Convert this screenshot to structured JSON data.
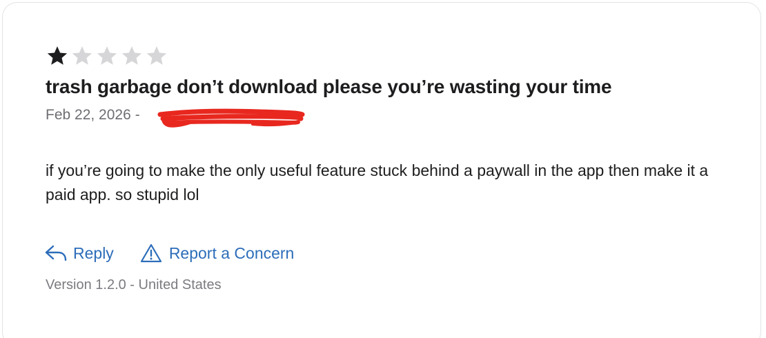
{
  "review": {
    "rating": 1,
    "max_rating": 5,
    "title": "trash garbage don’t download please you’re wasting your time",
    "date": "Feb 22, 2026",
    "separator": "-",
    "body": "if you’re going to make the only useful feature stuck behind a paywall in the app then make it a paid app. so stupid lol",
    "footer": "Version 1.2.0 - United States"
  },
  "actions": {
    "reply_label": "Reply",
    "reply_icon": "reply-arrow-icon",
    "report_label": "Report a Concern",
    "report_icon": "warning-triangle-icon"
  },
  "colors": {
    "star_filled": "#1d1d1f",
    "star_empty": "#d6d6d8",
    "link": "#2c6db9",
    "redaction": "#e8281f"
  }
}
